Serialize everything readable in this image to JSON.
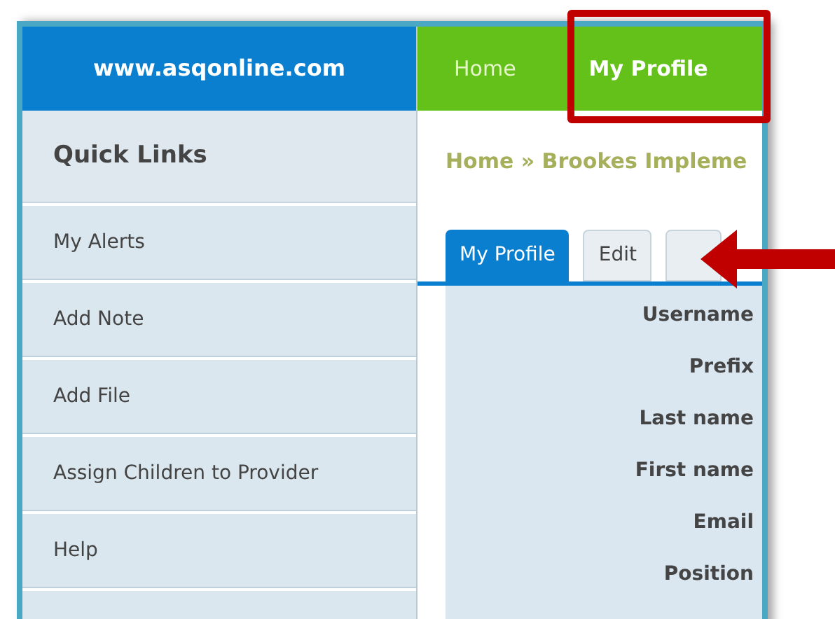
{
  "site": {
    "title": "www.asqonline.com"
  },
  "nav": [
    {
      "label": "Home",
      "selected": false
    },
    {
      "label": "My Profile",
      "selected": true
    }
  ],
  "sidebar": {
    "heading": "Quick Links",
    "items": [
      "My Alerts",
      "Add Note",
      "Add File",
      "Assign Children to Provider",
      "Help"
    ]
  },
  "breadcrumb": "Home » Brookes Impleme",
  "tabs": [
    {
      "label": "My Profile",
      "selected": true
    },
    {
      "label": "Edit",
      "selected": false
    },
    {
      "selected": false
    }
  ],
  "fields": [
    "Username",
    "Prefix",
    "Last name",
    "First name",
    "Email",
    "Position"
  ]
}
